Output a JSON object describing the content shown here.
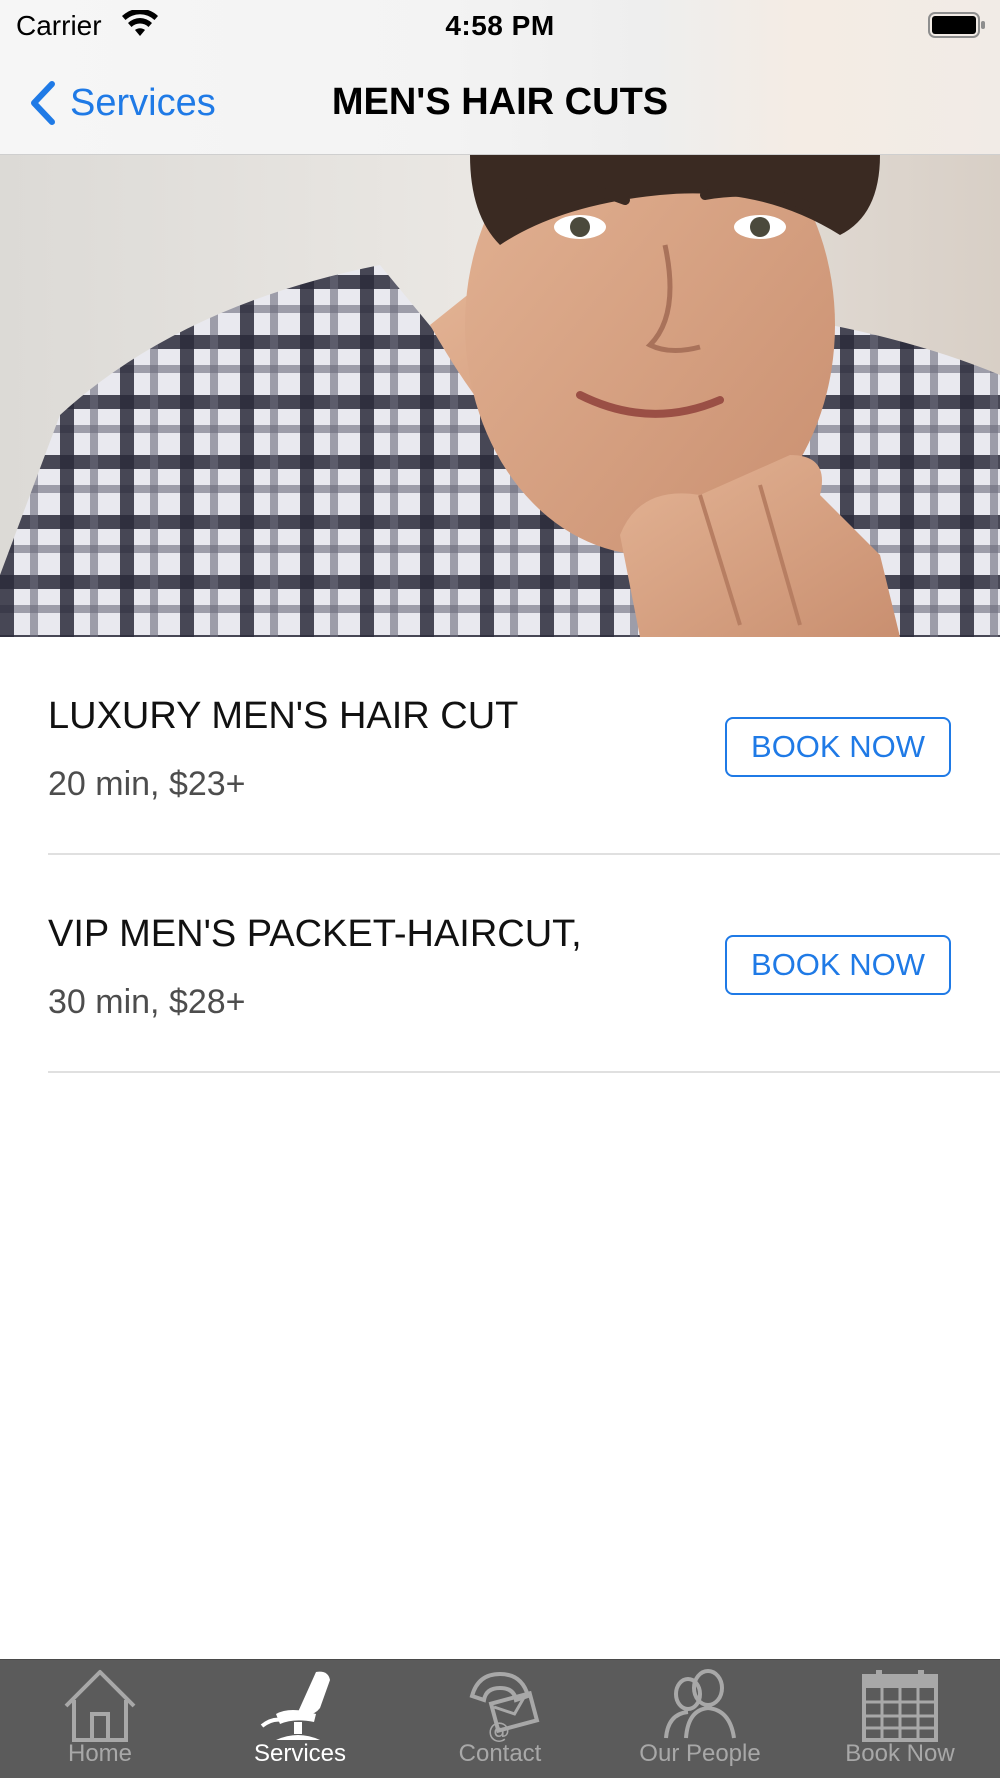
{
  "status_bar": {
    "carrier": "Carrier",
    "time": "4:58 PM",
    "icons": [
      "wifi-icon",
      "battery-icon"
    ]
  },
  "nav": {
    "back_label": "Services",
    "title": "MEN'S HAIR CUTS"
  },
  "services": [
    {
      "name": "LUXURY MEN'S HAIR CUT",
      "meta": "20 min, $23+",
      "button": "BOOK NOW"
    },
    {
      "name": "VIP MEN'S PACKET-HAIRCUT,",
      "meta": "30 min, $28+",
      "button": "BOOK NOW"
    }
  ],
  "tabbar": {
    "tabs": [
      {
        "label": "Home",
        "icon": "home-icon",
        "active": false
      },
      {
        "label": "Services",
        "icon": "barber-chair-icon",
        "active": true
      },
      {
        "label": "Contact",
        "icon": "phone-mail-icon",
        "active": false
      },
      {
        "label": "Our People",
        "icon": "people-icon",
        "active": false
      },
      {
        "label": "Book Now",
        "icon": "calendar-icon",
        "active": false
      }
    ]
  },
  "colors": {
    "accent": "#1f7ae6",
    "tabbar_bg": "#5b5b5b",
    "tab_inactive": "#a8a8a8",
    "tab_active": "#ffffff"
  }
}
